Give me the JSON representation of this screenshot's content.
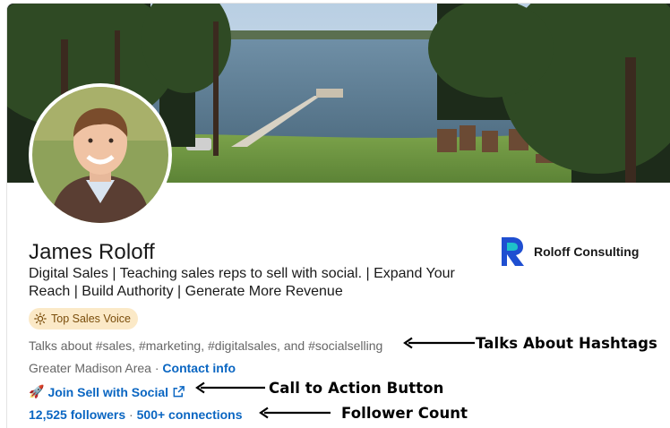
{
  "profile": {
    "name": "James Roloff",
    "headline": "Digital Sales | Teaching sales reps to sell with social. | Expand Your Reach | Build Authority | Generate More Revenue",
    "badge": "Top Sales Voice",
    "talks_about": "Talks about #sales, #marketing, #digitalsales, and #socialselling",
    "location": "Greater Madison Area",
    "location_sep": " · ",
    "contact_label": "Contact info",
    "cta_label": "Join Sell with Social",
    "cta_emoji": "🚀",
    "followers": "12,525 followers",
    "connections": "500+ connections",
    "stats_sep": " · "
  },
  "company": {
    "name": "Roloff Consulting",
    "logo_colors": [
      "#1f4fd1",
      "#1ec2c9"
    ]
  },
  "annotations": {
    "hashtags": "Talks About Hashtags",
    "cta": "Call to Action Button",
    "followers": "Follower Count"
  },
  "colors": {
    "link": "#0a66c2",
    "badge_bg": "#fbe9c7",
    "secondary_text": "#666666"
  }
}
